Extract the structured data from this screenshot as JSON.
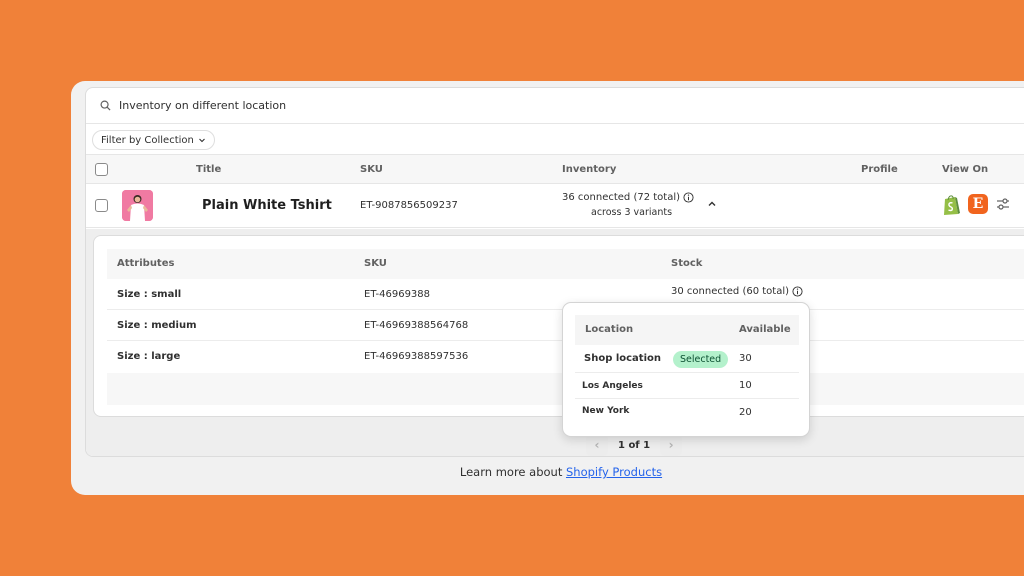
{
  "search": {
    "text": "Inventory on different location"
  },
  "filter": {
    "label": "Filter by Collection"
  },
  "table_headers": {
    "title": "Title",
    "sku": "SKU",
    "inventory": "Inventory",
    "profile": "Profile",
    "view_on": "View On"
  },
  "product": {
    "title": "Plain White Tshirt",
    "sku": "ET-9087856509237",
    "inventory_line1": "36 connected (72 total)",
    "inventory_line2": "across 3 variants",
    "thumbnail_icon": "tshirt-model-thumbnail",
    "view_on_icons": [
      "shopify-icon",
      "etsy-icon",
      "settings-sliders-icon"
    ],
    "etsy_letter": "E"
  },
  "variants_headers": {
    "attributes": "Attributes",
    "sku": "SKU",
    "stock": "Stock"
  },
  "variants": [
    {
      "attribute": "Size : small",
      "sku": "ET-46969388",
      "stock": "30 connected (60 total)"
    },
    {
      "attribute": "Size : medium",
      "sku": "ET-46969388564768"
    },
    {
      "attribute": "Size : large",
      "sku": "ET-46969388597536"
    }
  ],
  "popover": {
    "headers": {
      "location": "Location",
      "available": "Available"
    },
    "rows": [
      {
        "location": "Shop location",
        "badge": "Selected",
        "available": "30"
      },
      {
        "location": "Los Angeles",
        "available": "10"
      },
      {
        "location": "New York",
        "available": "20"
      }
    ]
  },
  "pagination": {
    "label": "1 of 1",
    "prev": "‹",
    "next": "›"
  },
  "footer": {
    "prefix": "Learn more about",
    "link": "Shopify Products"
  },
  "colors": {
    "background": "#f08139",
    "badge_bg": "#b4f1cc",
    "link": "#2463eb",
    "etsy": "#f1641e",
    "shopify": "#95bf47"
  }
}
